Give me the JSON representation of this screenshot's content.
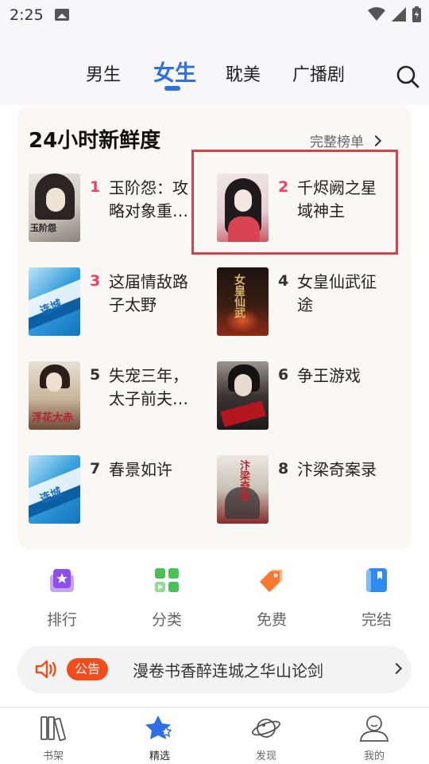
{
  "status_bar": {
    "time": "2:25"
  },
  "header": {
    "tabs": [
      {
        "label": "男生",
        "active": false
      },
      {
        "label": "女生",
        "active": true
      },
      {
        "label": "耽美",
        "active": false
      },
      {
        "label": "广播剧",
        "active": false
      }
    ],
    "accent_color": "#2f6fe6"
  },
  "ranking": {
    "title": "24小时新鲜度",
    "more_label": "完整榜单",
    "books": [
      {
        "rank": "1",
        "name": "玉阶怨：攻略对象重…"
      },
      {
        "rank": "2",
        "name": "千烬阙之星域神主"
      },
      {
        "rank": "3",
        "name": "这届情敌路子太野"
      },
      {
        "rank": "4",
        "name": "女皇仙武征途"
      },
      {
        "rank": "5",
        "name": "失宠三年，太子前夫…"
      },
      {
        "rank": "6",
        "name": "争王游戏"
      },
      {
        "rank": "7",
        "name": "春景如许"
      },
      {
        "rank": "8",
        "name": "汴梁奇案录"
      }
    ],
    "cover_texts": {
      "cover_1": "玉阶怨",
      "cover_blue": "连城",
      "cover_4": "女皇仙武",
      "cover_5": "浮花大赤",
      "cover_8": "汴梁奇案"
    }
  },
  "quick_entries": [
    {
      "label": "排行",
      "icon": "ranking-icon"
    },
    {
      "label": "分类",
      "icon": "category-icon"
    },
    {
      "label": "免费",
      "icon": "free-tag-icon"
    },
    {
      "label": "完结",
      "icon": "finished-book-icon"
    }
  ],
  "notice": {
    "badge": "公告",
    "text": "漫卷书香醉连城之华山论剑"
  },
  "bottom_nav": [
    {
      "label": "书架",
      "icon": "bookshelf-icon",
      "active": false
    },
    {
      "label": "精选",
      "icon": "featured-star-icon",
      "active": true
    },
    {
      "label": "发现",
      "icon": "discover-planet-icon",
      "active": false
    },
    {
      "label": "我的",
      "icon": "profile-icon",
      "active": false
    }
  ]
}
